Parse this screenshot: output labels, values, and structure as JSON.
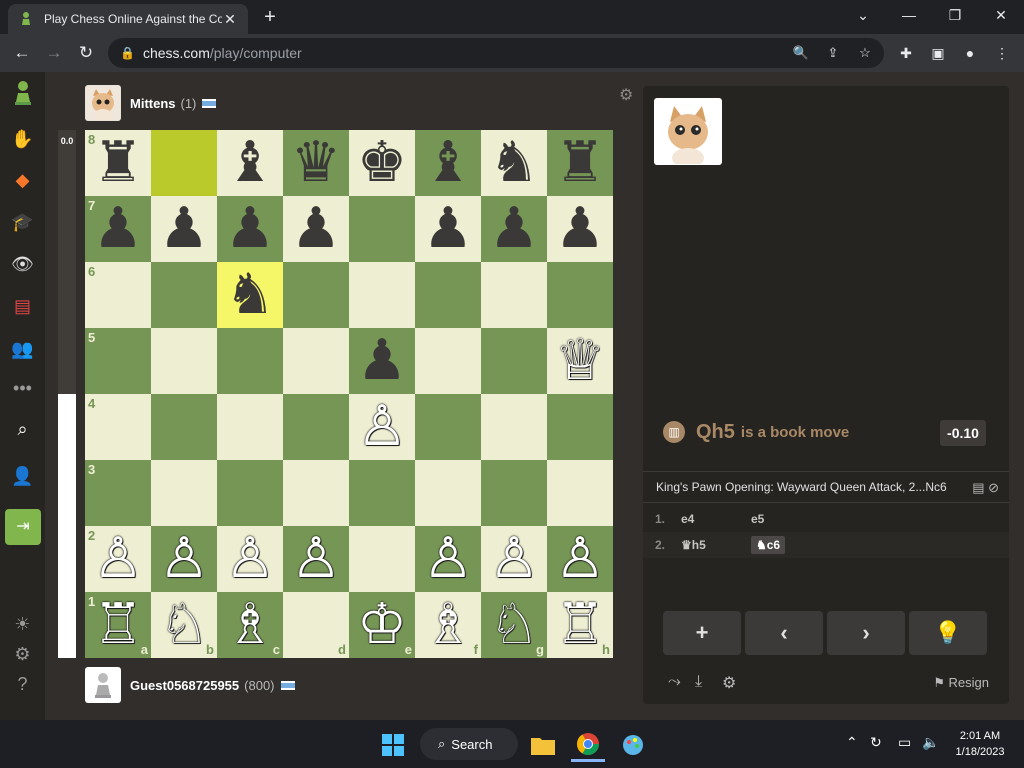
{
  "browser": {
    "tab_title": "Play Chess Online Against the Co",
    "url_host": "chess.com",
    "url_path": "/play/computer"
  },
  "top_player": {
    "name": "Mittens",
    "rating": "(1)"
  },
  "bottom_player": {
    "name": "Guest0568725955",
    "rating": "(800)"
  },
  "eval_bar": {
    "label": "0.0",
    "white_fraction": 0.5
  },
  "board": {
    "ranks": [
      "8",
      "7",
      "6",
      "5",
      "4",
      "3",
      "2",
      "1"
    ],
    "files": [
      "a",
      "b",
      "c",
      "d",
      "e",
      "f",
      "g",
      "h"
    ],
    "rows": [
      [
        "♜",
        "",
        "♝",
        "♛",
        "♚",
        "♝",
        "♞",
        "♜"
      ],
      [
        "♟",
        "♟",
        "♟",
        "♟",
        "",
        "♟",
        "♟",
        "♟"
      ],
      [
        "",
        "",
        "♞",
        "",
        "",
        "",
        "",
        ""
      ],
      [
        "",
        "",
        "",
        "",
        "♟",
        "",
        "",
        "♕"
      ],
      [
        "",
        "",
        "",
        "",
        "♙",
        "",
        "",
        ""
      ],
      [
        "",
        "",
        "",
        "",
        "",
        "",
        "",
        ""
      ],
      [
        "♙",
        "♙",
        "♙",
        "♙",
        "",
        "♙",
        "♙",
        "♙"
      ],
      [
        "♖",
        "♘",
        "♗",
        "",
        "♔",
        "♗",
        "♘",
        "♖"
      ]
    ],
    "colors": [
      [
        "b",
        "b",
        "b",
        "b",
        "b",
        "b",
        "b",
        "b"
      ],
      [
        "b",
        "b",
        "b",
        "b",
        "",
        "b",
        "b",
        "b"
      ],
      [
        "",
        "",
        "b",
        "",
        "",
        "",
        "",
        ""
      ],
      [
        "",
        "",
        "",
        "",
        "b",
        "",
        "",
        "w"
      ],
      [
        "",
        "",
        "",
        "",
        "w",
        "",
        "",
        ""
      ],
      [
        "",
        "",
        "",
        "",
        "",
        "",
        "",
        ""
      ],
      [
        "w",
        "w",
        "w",
        "w",
        "",
        "w",
        "w",
        "w"
      ],
      [
        "w",
        "w",
        "w",
        "",
        "w",
        "w",
        "w",
        "w"
      ]
    ],
    "highlights": [
      "b8",
      "c6"
    ]
  },
  "panel": {
    "book_move": "Qh5",
    "book_text": "is a book move",
    "eval": "-0.10",
    "opening": "King's Pawn Opening: Wayward Queen Attack, 2...Nc6",
    "moves": [
      {
        "num": "1.",
        "white": "e4",
        "black": "e5"
      },
      {
        "num": "2.",
        "white": "♛h5",
        "black": "♞c6"
      }
    ],
    "controls": [
      "+",
      "‹",
      "›",
      "💡"
    ],
    "resign_label": "Resign"
  },
  "taskbar": {
    "search_label": "Search",
    "time": "2:01 AM",
    "date": "1/18/2023"
  }
}
